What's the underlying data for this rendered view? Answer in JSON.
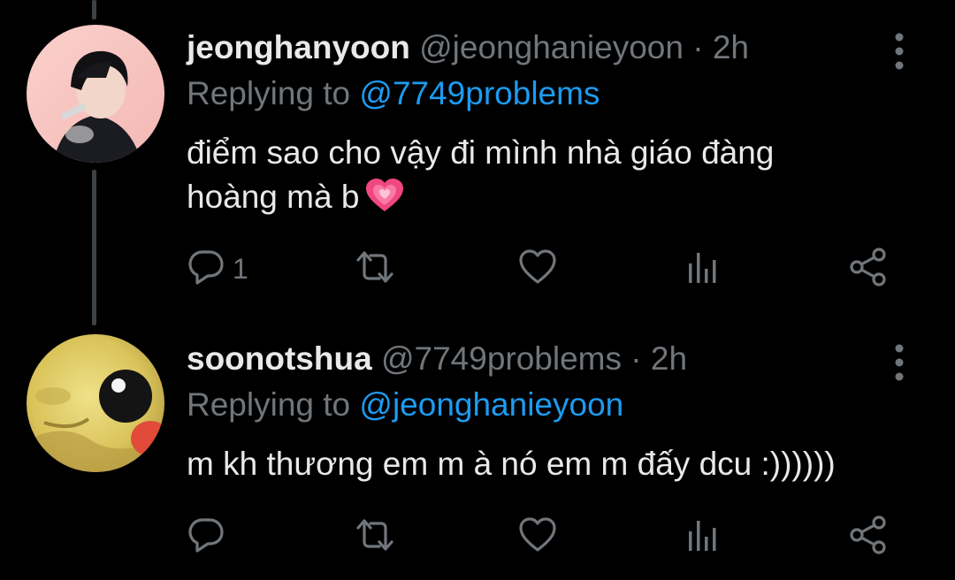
{
  "tweets": [
    {
      "display_name": "jeonghanyoon",
      "handle": "@jeonghanieyoon",
      "separator": "·",
      "time": "2h",
      "replying_prefix": "Replying to",
      "replying_to": "@7749problems",
      "text_line1": "điểm sao cho vậy đi mình nhà giáo đàng",
      "text_line2": "hoàng mà b",
      "emoji": "growing-heart",
      "reply_count": "1",
      "retweet_count": "",
      "like_count": ""
    },
    {
      "display_name": "soonotshua",
      "handle": "@7749problems",
      "separator": "·",
      "time": "2h",
      "replying_prefix": "Replying to",
      "replying_to": "@jeonghanieyoon",
      "text_line1": "m kh thương em m à nó em m đấy dcu :))))))",
      "reply_count": "",
      "retweet_count": "",
      "like_count": ""
    }
  ],
  "colors": {
    "background": "#000000",
    "primary_text": "#e7e9ea",
    "secondary_text": "#71767b",
    "link": "#1d9bf0",
    "thread_line": "#3d4246",
    "emoji_heart": "#f0487e"
  },
  "icons": {
    "reply": "reply-icon",
    "retweet": "retweet-icon",
    "like": "like-icon",
    "analytics": "analytics-icon",
    "share": "share-icon",
    "more": "more-icon"
  }
}
